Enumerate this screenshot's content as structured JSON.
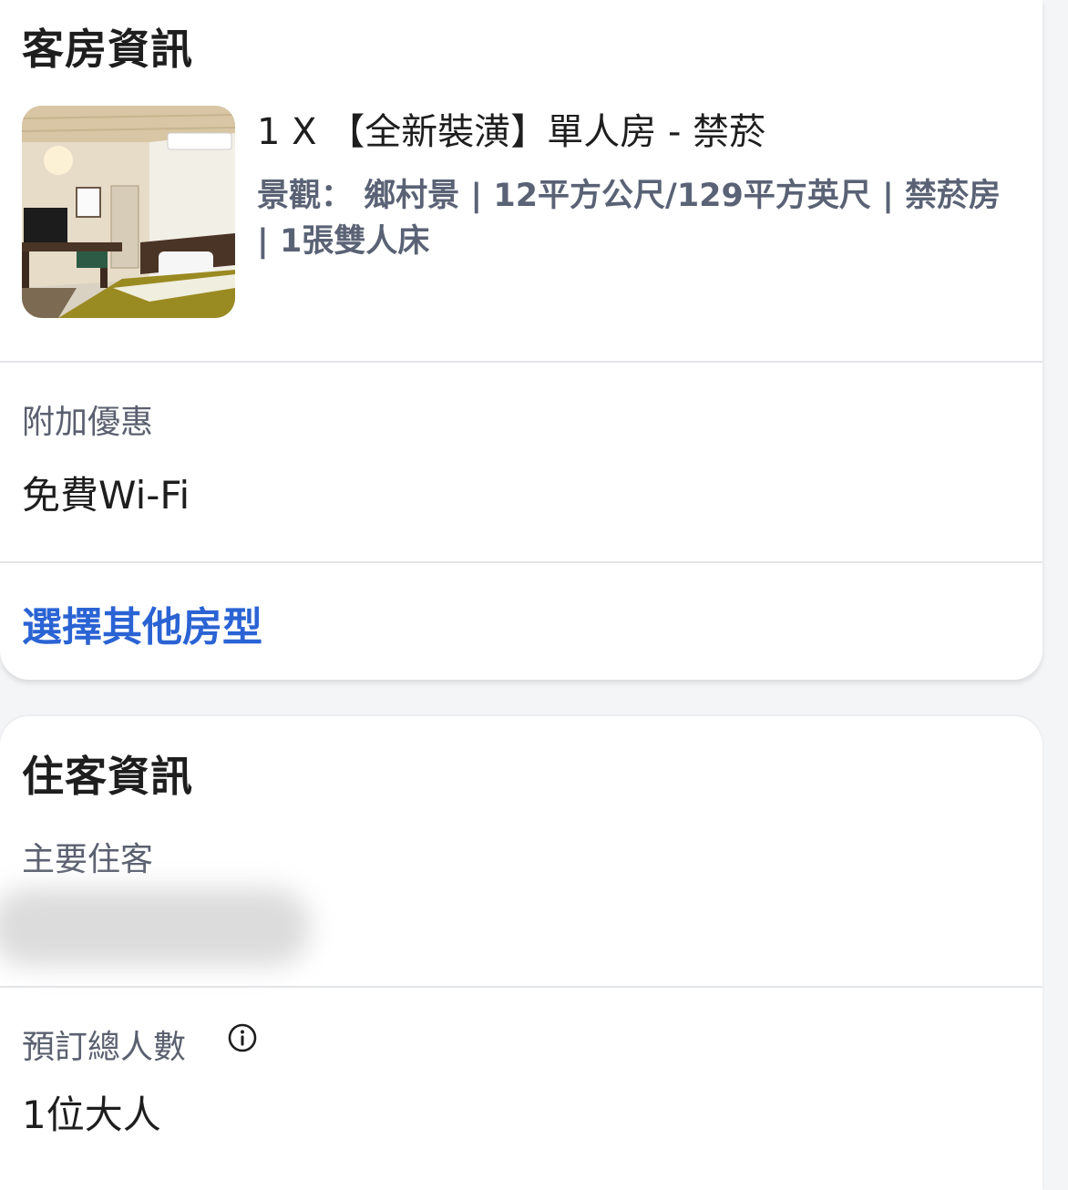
{
  "room_section": {
    "title": "客房資訊",
    "room_name": "1 X 【全新裝潢】單人房 - 禁菸",
    "room_details": "景觀： 鄉村景 | 12平方公尺/129平方英尺 | 禁菸房 | 1張雙人床",
    "perks_label": "附加優惠",
    "perks_value": "免費Wi-Fi",
    "change_room_link": "選擇其他房型"
  },
  "guest_section": {
    "title": "住客資訊",
    "primary_guest_label": "主要住客",
    "total_guests_label": "預訂總人數",
    "total_guests_value": "1位大人",
    "info_icon": "info-icon"
  },
  "colors": {
    "link": "#2a63d4",
    "label": "#5b6070",
    "details": "#5a6275"
  }
}
